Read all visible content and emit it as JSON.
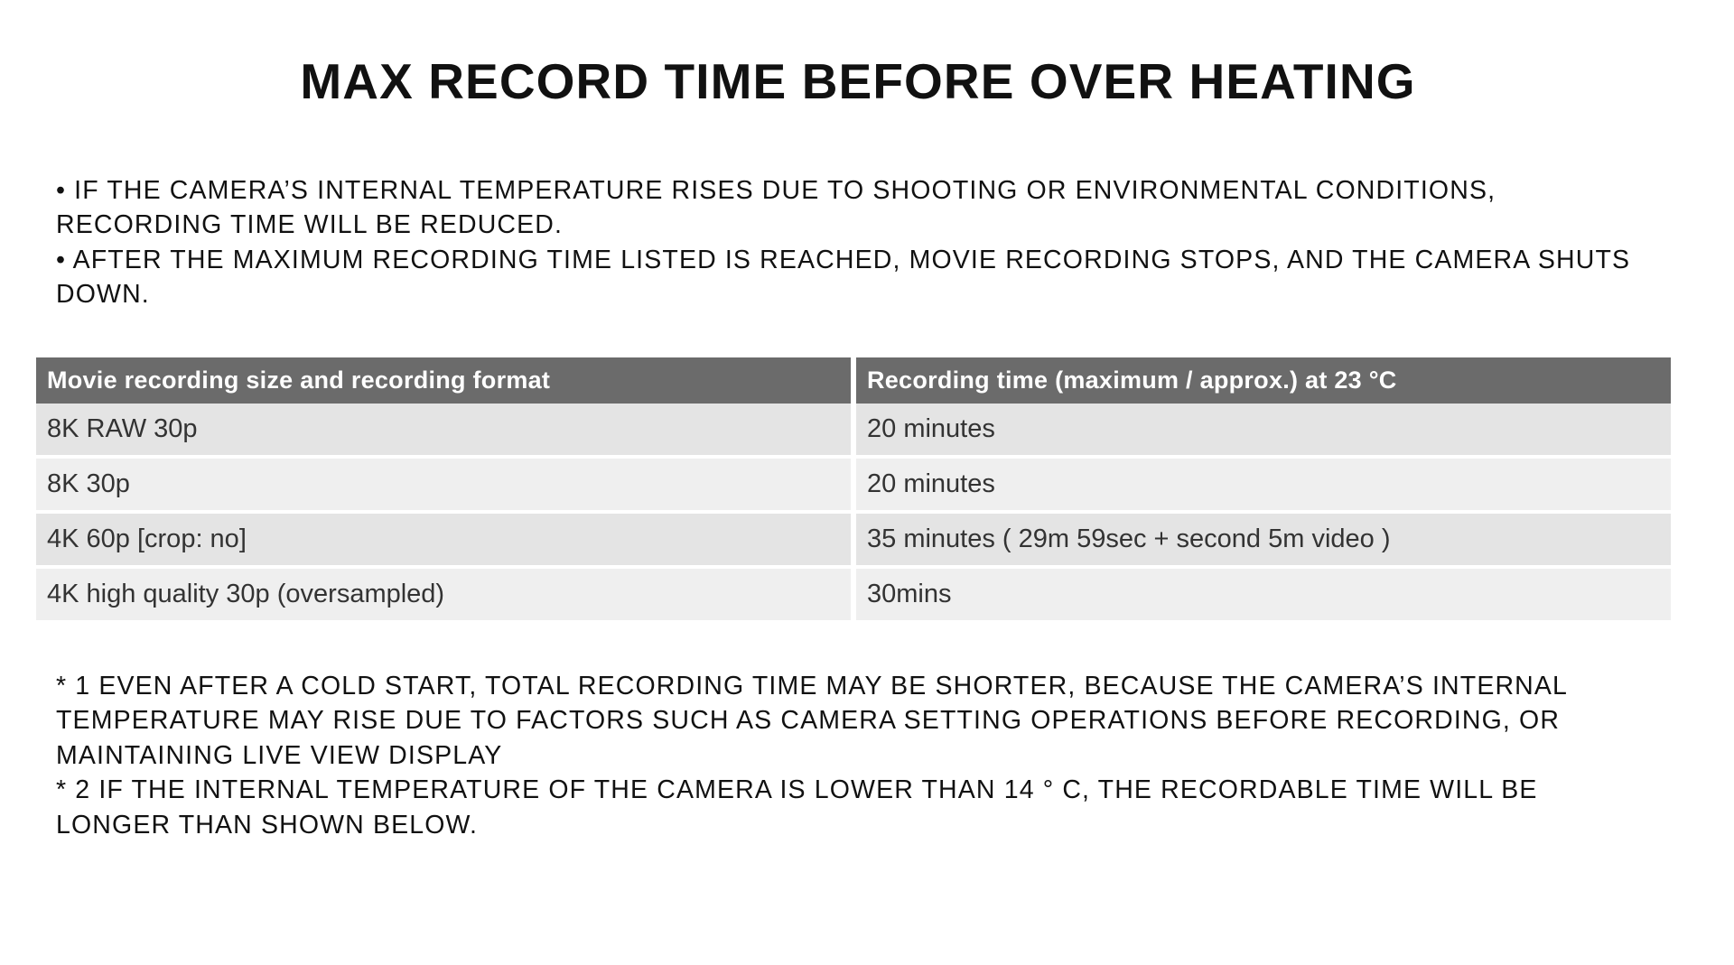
{
  "title": "MAX RECORD TIME BEFORE OVER HEATING",
  "intro": {
    "b1": "• IF THE CAMERA’S INTERNAL TEMPERATURE RISES DUE TO SHOOTING OR ENVIRONMENTAL CONDITIONS, RECORDING TIME WILL BE REDUCED.",
    "b2": "• AFTER THE MAXIMUM RECORDING TIME LISTED IS REACHED, MOVIE RECORDING STOPS, AND THE CAMERA SHUTS DOWN."
  },
  "table": {
    "head": {
      "c1": "Movie recording size and recording format",
      "c2": "Recording time (maximum / approx.) at 23 °C"
    },
    "rows": [
      {
        "c1": "8K RAW 30p",
        "c2": "20 minutes"
      },
      {
        "c1": "8K 30p",
        "c2": "20 minutes"
      },
      {
        "c1": "4K 60p [crop: no]",
        "c2": "35 minutes ( 29m 59sec + second 5m video )"
      },
      {
        "c1": "4K high quality 30p (oversampled)",
        "c2": "30mins"
      }
    ]
  },
  "foot": {
    "n1": "* 1 EVEN AFTER A COLD START, TOTAL RECORDING TIME MAY BE SHORTER, BECAUSE THE CAMERA’S INTERNAL TEMPERATURE MAY RISE DUE TO FACTORS SUCH AS CAMERA SETTING OPERATIONS BEFORE RECORDING, OR MAINTAINING LIVE VIEW DISPLAY",
    "n2": "* 2 IF THE INTERNAL TEMPERATURE OF THE CAMERA IS LOWER THAN 14 ° C, THE RECORDABLE TIME WILL BE LONGER THAN SHOWN BELOW."
  },
  "chart_data": {
    "type": "table",
    "title": "MAX RECORD TIME BEFORE OVER HEATING",
    "condition": "Recording time (maximum / approx.) at 23 °C",
    "columns": [
      "Movie recording size and recording format",
      "Recording time (maximum / approx.) at 23 °C"
    ],
    "rows": [
      [
        "8K RAW 30p",
        "20 minutes"
      ],
      [
        "8K 30p",
        "20 minutes"
      ],
      [
        "4K 60p [crop: no]",
        "35 minutes ( 29m 59sec + second 5m video )"
      ],
      [
        "4K high quality 30p (oversampled)",
        "30mins"
      ]
    ]
  }
}
